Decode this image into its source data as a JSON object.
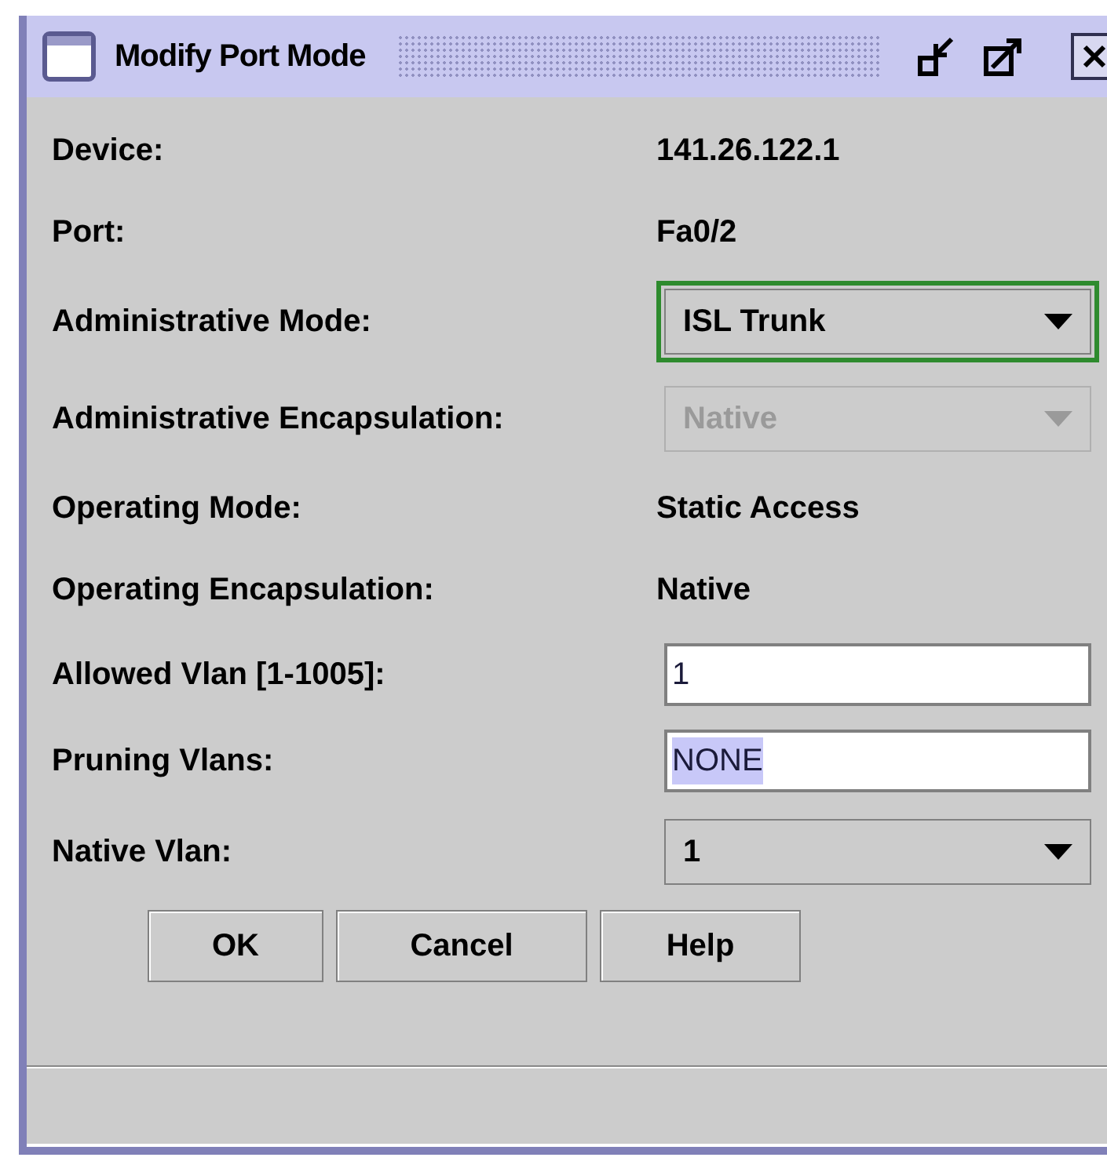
{
  "window": {
    "title": "Modify Port Mode"
  },
  "rows": [
    {
      "kind": "text",
      "label": "Device:",
      "value": "141.26.122.1"
    },
    {
      "kind": "text",
      "label": "Port:",
      "value": "Fa0/2"
    },
    {
      "kind": "combo",
      "label": "Administrative Mode:",
      "value": "ISL Trunk",
      "focused": true,
      "disabled": false
    },
    {
      "kind": "combo",
      "label": "Administrative Encapsulation:",
      "value": "Native",
      "focused": false,
      "disabled": true
    },
    {
      "kind": "text",
      "label": "Operating Mode:",
      "value": "Static Access"
    },
    {
      "kind": "text",
      "label": "Operating Encapsulation:",
      "value": "Native"
    },
    {
      "kind": "field",
      "label": "Allowed Vlan [1-1005]:",
      "value": "1",
      "text_selected": false
    },
    {
      "kind": "field",
      "label": "Pruning Vlans:",
      "value": "NONE",
      "text_selected": true
    },
    {
      "kind": "combo",
      "label": "Native Vlan:",
      "value": "1",
      "focused": false,
      "disabled": false
    }
  ],
  "buttons": [
    "OK",
    "Cancel",
    "Help"
  ]
}
